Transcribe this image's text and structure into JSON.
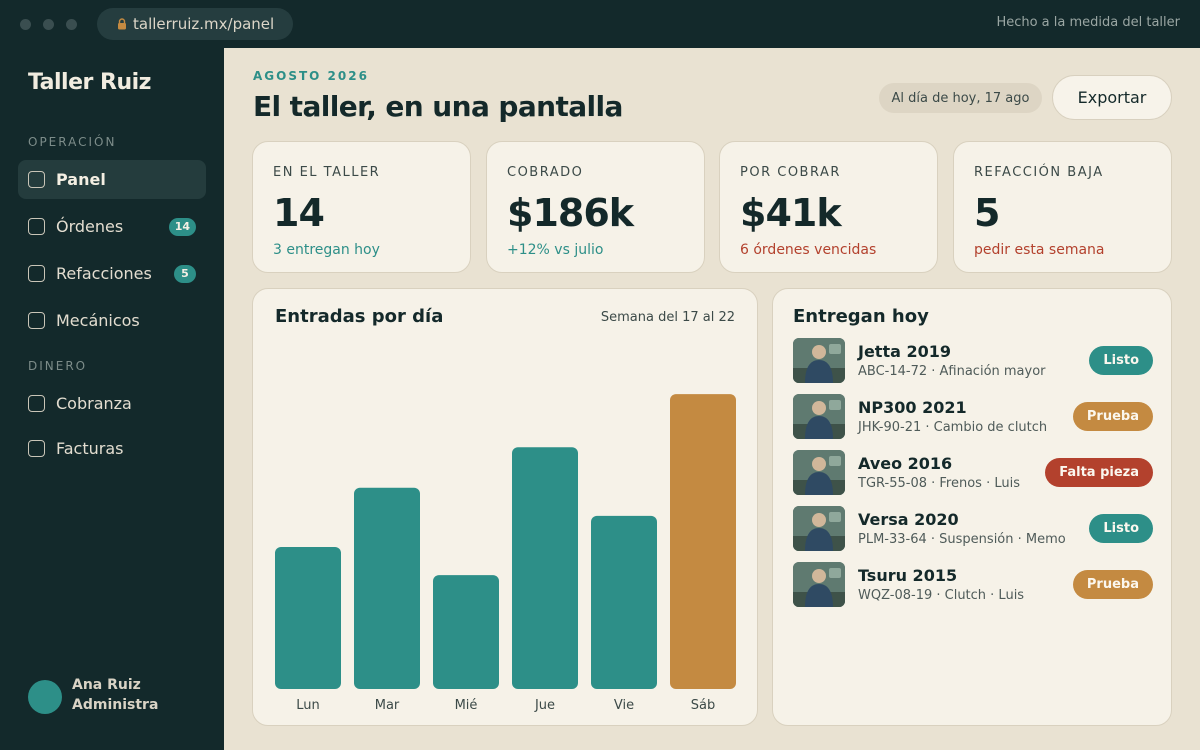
{
  "browser": {
    "url": "tallerruiz.mx/panel",
    "tagline": "Hecho a la medida del taller"
  },
  "sidebar": {
    "brand": "Taller Ruiz",
    "sections": [
      {
        "label": "OPERACIÓN"
      },
      {
        "label": "DINERO"
      }
    ],
    "items": [
      {
        "label": "Panel",
        "active": true
      },
      {
        "label": "Órdenes",
        "badge": "14"
      },
      {
        "label": "Refacciones",
        "badge": "5"
      },
      {
        "label": "Mecánicos"
      },
      {
        "label": "Cobranza"
      },
      {
        "label": "Facturas"
      }
    ],
    "user": {
      "name": "Ana Ruiz",
      "role": "Administra"
    }
  },
  "header": {
    "eyebrow": "AGOSTO 2026",
    "title": "El taller, en una pantalla",
    "date_chip": "Al día de hoy, 17 ago",
    "export_label": "Exportar"
  },
  "stats": [
    {
      "label": "EN EL TALLER",
      "value": "14",
      "note": "3 entregan hoy",
      "note_color": "#2d8f88"
    },
    {
      "label": "COBRADO",
      "value": "$186k",
      "note": "+12% vs julio",
      "note_color": "#2d8f88"
    },
    {
      "label": "POR COBRAR",
      "value": "$41k",
      "note": "6 órdenes vencidas",
      "note_color": "#b3412d"
    },
    {
      "label": "REFACCIÓN BAJA",
      "value": "5",
      "note": "pedir esta semana",
      "note_color": "#b3412d"
    }
  ],
  "chart_card": {
    "title": "Entradas por día",
    "subtitle": "Semana del 17 al 22"
  },
  "chart_data": {
    "type": "bar",
    "categories": [
      "Lun",
      "Mar",
      "Mié",
      "Jue",
      "Vie",
      "Sáb"
    ],
    "values": [
      9.1,
      12.9,
      7.3,
      15.5,
      11.1,
      18.9
    ],
    "ylim": [
      0,
      20
    ],
    "grid": false,
    "colors": {
      "default": "#2d8f88",
      "highlight": "#c48a41"
    },
    "highlight_index": 5
  },
  "deliveries": {
    "title": "Entregan hoy",
    "rows": [
      {
        "vehicle": "Jetta 2019",
        "meta": "ABC-14-72 · Afinación mayor",
        "status": "Listo",
        "status_color": "#2d8f88"
      },
      {
        "vehicle": "NP300 2021",
        "meta": "JHK-90-21 · Cambio de clutch",
        "status": "Prueba",
        "status_color": "#c48a41"
      },
      {
        "vehicle": "Aveo 2016",
        "meta": "TGR-55-08 · Frenos · Luis",
        "status": "Falta pieza",
        "status_color": "#b3412d"
      },
      {
        "vehicle": "Versa 2020",
        "meta": "PLM-33-64 · Suspensión · Memo",
        "status": "Listo",
        "status_color": "#2d8f88"
      },
      {
        "vehicle": "Tsuru 2015",
        "meta": "WQZ-08-19 · Clutch · Luis",
        "status": "Prueba",
        "status_color": "#c48a41"
      }
    ]
  }
}
